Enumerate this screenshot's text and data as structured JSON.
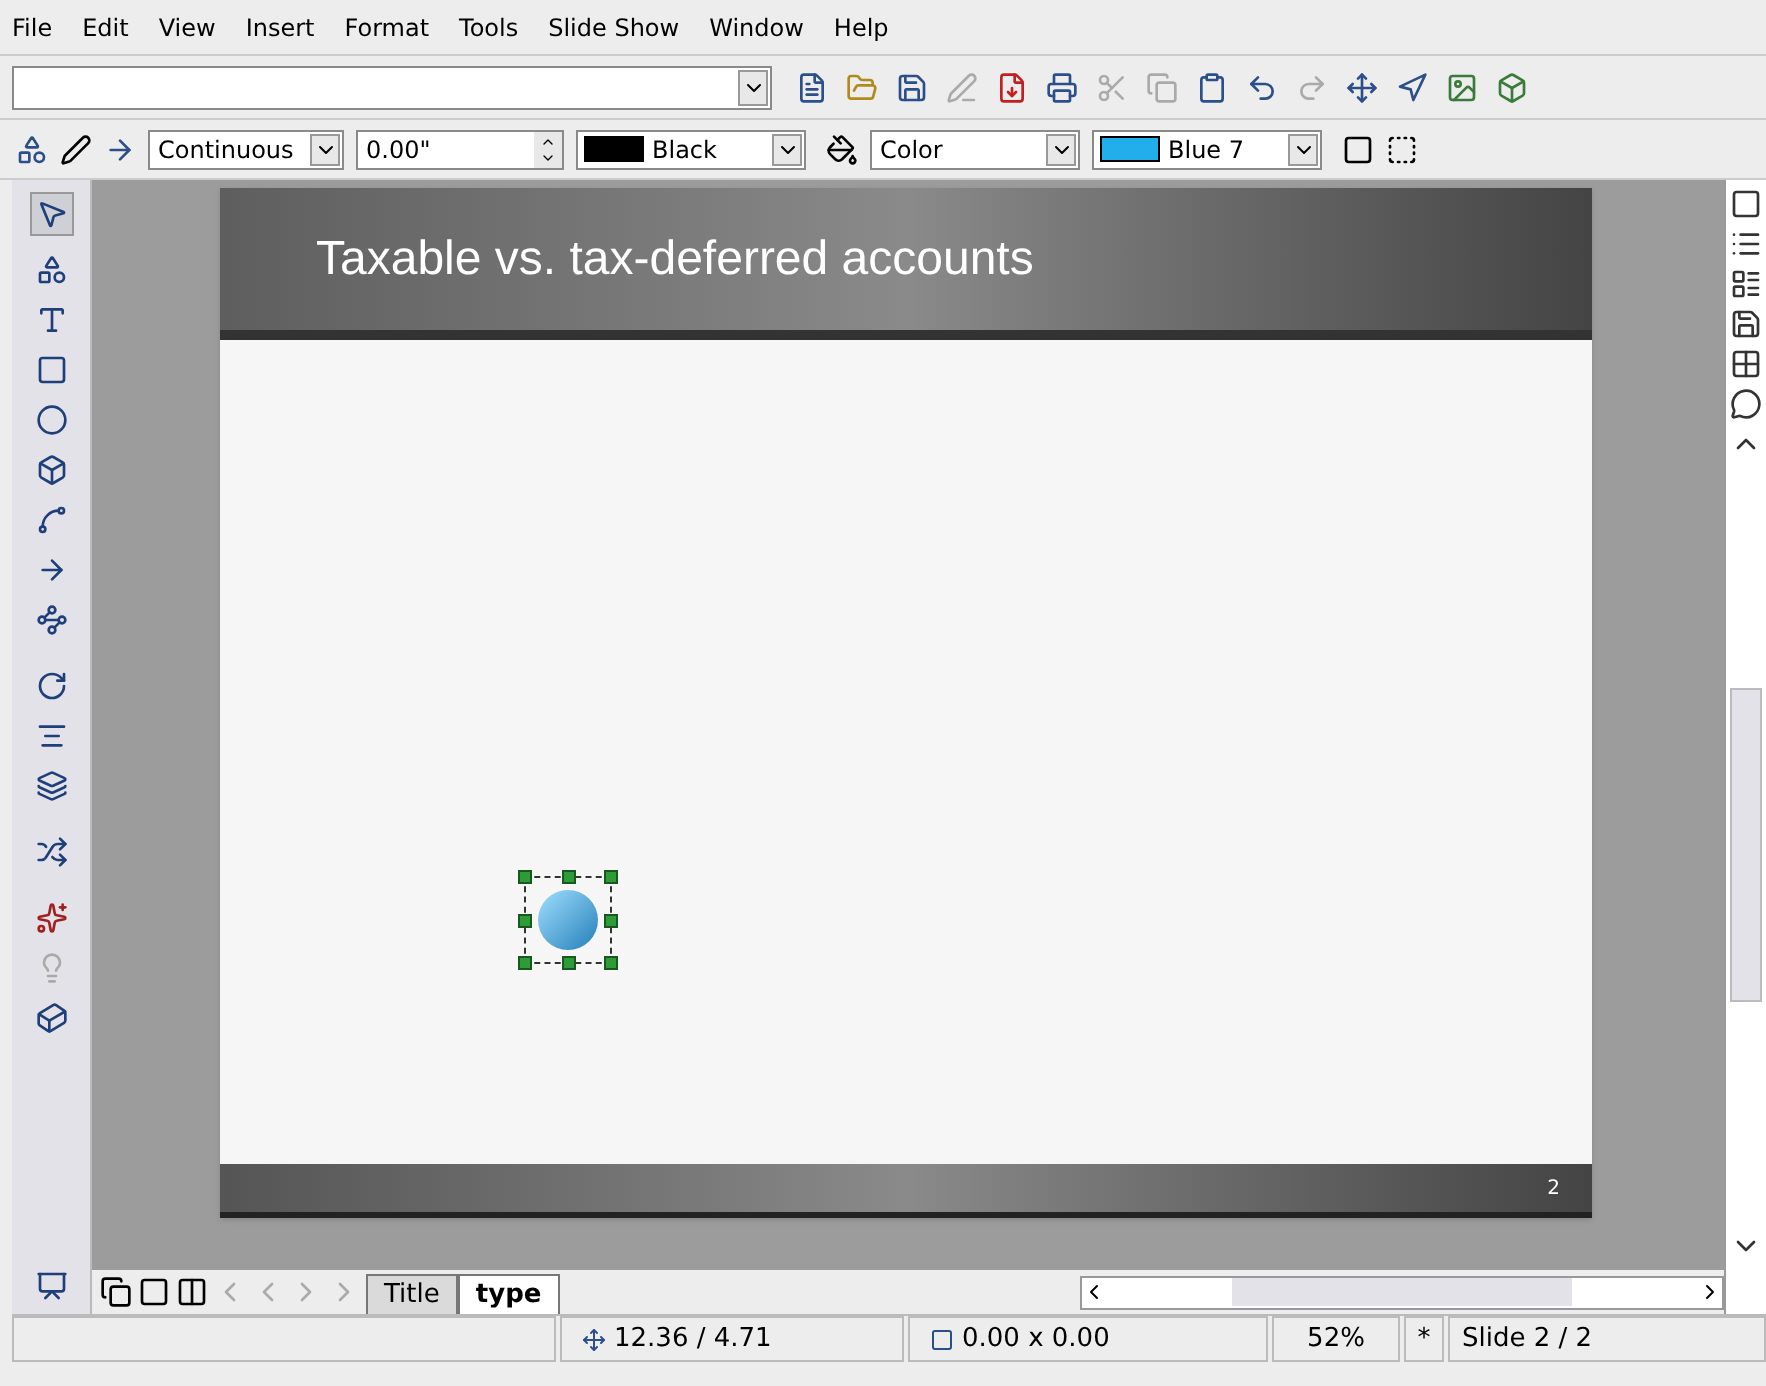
{
  "menu": [
    "File",
    "Edit",
    "View",
    "Insert",
    "Format",
    "Tools",
    "Slide Show",
    "Window",
    "Help"
  ],
  "line_toolbar": {
    "line_style": "Continuous",
    "line_width": "0.00\"",
    "line_color": "Black",
    "area_style": "Color",
    "area_fill": "Blue 7"
  },
  "slide": {
    "title": "Taxable vs. tax-deferred accounts",
    "number": "2"
  },
  "tabs": [
    {
      "label": "Title",
      "selected": false
    },
    {
      "label": "type",
      "selected": true
    }
  ],
  "status_bar": {
    "position": "12.36 / 4.71",
    "size": "0.00 x 0.00",
    "zoom": "52%",
    "modified": "*",
    "slide": "Slide 2 / 2"
  }
}
